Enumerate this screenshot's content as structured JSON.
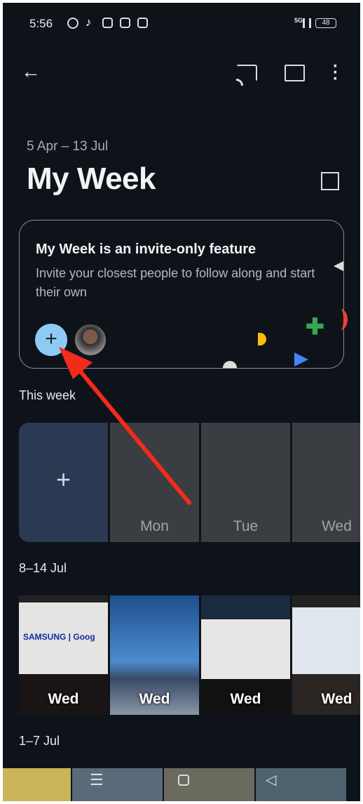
{
  "status_bar": {
    "time": "5:56",
    "network": "5G",
    "battery": "48",
    "notification_icons": [
      "whatsapp-icon",
      "tiktok-icon",
      "instagram-icon",
      "instagram-icon",
      "instagram-icon"
    ]
  },
  "toolbar": {
    "back": "arrow-back-icon",
    "cast": "cast-icon",
    "comment": "comment-icon",
    "more": "more-vert-icon"
  },
  "header": {
    "date_range": "5 Apr – 13 Jul",
    "title": "My Week",
    "layout_icon": "grid-icon"
  },
  "invite_card": {
    "title": "My Week is an invite-only feature",
    "subtitle": "Invite your closest people to follow along and start their own",
    "add_label": "+"
  },
  "this_week": {
    "label": "This week",
    "add_label": "+",
    "days": [
      "Mon",
      "Tue",
      "Wed"
    ]
  },
  "week_8_14": {
    "label": "8–14 Jul",
    "photos": [
      {
        "day": "Wed",
        "caption": "SAMSUNG | Goog"
      },
      {
        "day": "Wed"
      },
      {
        "day": "Wed"
      },
      {
        "day": "Wed"
      }
    ]
  },
  "week_1_7": {
    "label": "1–7 Jul"
  },
  "colors": {
    "background": "#0e131a",
    "accent": "#8ecbf4",
    "annotation_arrow": "#f22b1a"
  }
}
